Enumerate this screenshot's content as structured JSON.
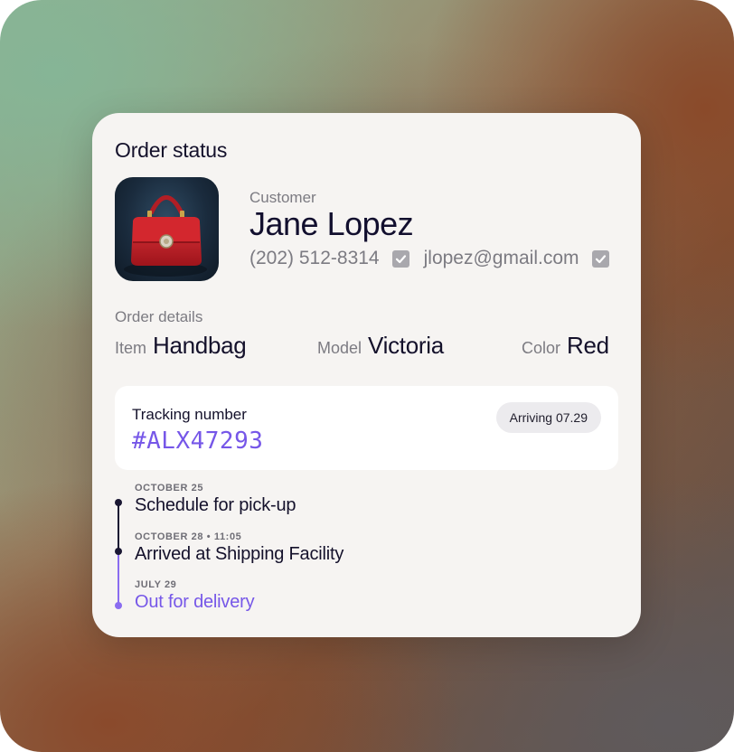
{
  "card": {
    "title": "Order status"
  },
  "customer": {
    "label": "Customer",
    "name": "Jane Lopez",
    "phone": "(202) 512-8314",
    "email": "jlopez@gmail.com"
  },
  "order_details": {
    "label": "Order details",
    "items": [
      {
        "key": "Item",
        "value": "Handbag"
      },
      {
        "key": "Model",
        "value": "Victoria"
      },
      {
        "key": "Color",
        "value": "Red"
      }
    ]
  },
  "tracking": {
    "label": "Tracking number",
    "number": "#ALX47293",
    "badge": "Arriving 07.29"
  },
  "timeline": [
    {
      "date": "OCTOBER 25",
      "event": "Schedule for pick-up",
      "state": "done"
    },
    {
      "date": "OCTOBER 28 • 11:05",
      "event": "Arrived at Shipping Facility",
      "state": "done"
    },
    {
      "date": "JULY 29",
      "event": "Out for delivery",
      "state": "current"
    }
  ],
  "colors": {
    "accent": "#7657e8",
    "text_primary": "#14112b",
    "text_muted": "#7c7b82",
    "card_bg": "#f6f4f2",
    "product_red": "#c8242c"
  },
  "icons": {
    "phone_verified": "checkbox-checked-icon",
    "email_verified": "checkbox-checked-icon",
    "product_image": "red-handbag-photo"
  }
}
